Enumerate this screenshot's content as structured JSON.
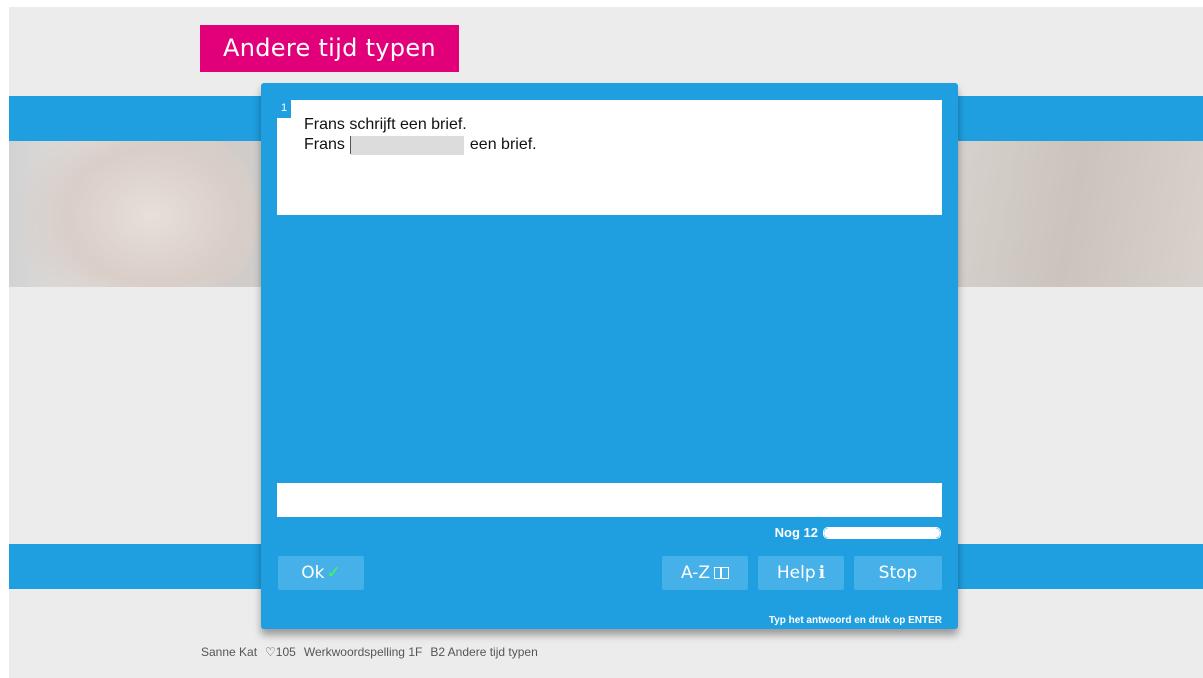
{
  "header": {
    "title": "Andere tijd typen"
  },
  "question": {
    "number": "1",
    "line1": "Frans schrijft een brief.",
    "line2_before": "Frans",
    "line2_after": "een brief."
  },
  "answer": {
    "value": "",
    "placeholder": ""
  },
  "progress": {
    "label": "Nog 12",
    "fraction": 1.0
  },
  "buttons": {
    "ok": "Ok",
    "az": "A-Z",
    "help": "Help",
    "stop": "Stop"
  },
  "icons": {
    "ok": "check-icon",
    "az": "book-icon",
    "help": "info-icon"
  },
  "hint": "Typ het antwoord en druk op ENTER",
  "footer": {
    "user": "Sanne Kat",
    "score": "♡105",
    "course": "Werkwoordspelling 1F",
    "lesson": "B2 Andere tijd typen"
  },
  "colors": {
    "accent": "#1f9fe0",
    "brand": "#e2007a",
    "check": "#3cff4a"
  }
}
